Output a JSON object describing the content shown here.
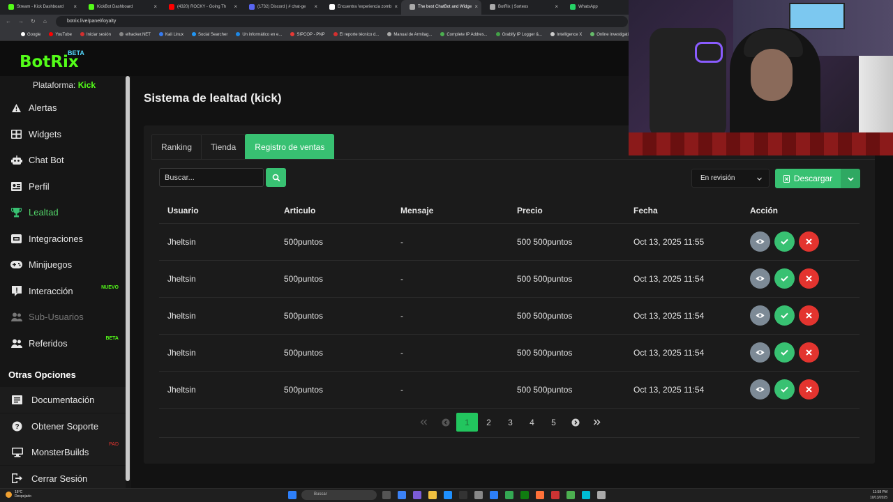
{
  "browser": {
    "tabs": [
      {
        "title": "Stream - Kick Dashboard",
        "color": "#53fc18"
      },
      {
        "title": "KickBot Dashboard",
        "color": "#53fc18"
      },
      {
        "title": "(4320) ROCKY - Going Th",
        "color": "#ff0000"
      },
      {
        "title": "(1732) Discord | # chat-ge",
        "color": "#5865f2"
      },
      {
        "title": "Encuentra 'experiencia zomb",
        "color": "#ffffff"
      },
      {
        "title": "The best ChatBot and Widge",
        "color": "#aaaaaa"
      },
      {
        "title": "BotRix | Sorteos",
        "color": "#aaaaaa"
      },
      {
        "title": "WhatsApp",
        "color": "#25d366"
      }
    ],
    "url": "botrix.live/panel/loyalty",
    "bookmarks": [
      {
        "label": "Google",
        "color": "#ffffff"
      },
      {
        "label": "YouTube",
        "color": "#ff0000"
      },
      {
        "label": "Iniciar sesión",
        "color": "#d32f2f"
      },
      {
        "label": "elhacker.NET",
        "color": "#888888"
      },
      {
        "label": "Kali Linux",
        "color": "#367bf0"
      },
      {
        "label": "Social Searcher",
        "color": "#2196f3"
      },
      {
        "label": "Un informático en e...",
        "color": "#1e88e5"
      },
      {
        "label": "SIPCOP - PNP",
        "color": "#e53935"
      },
      {
        "label": "El reporte técnico d...",
        "color": "#d32f2f"
      },
      {
        "label": "Manual de Armitag...",
        "color": "#aaaaaa"
      },
      {
        "label": "Complete IP Addres...",
        "color": "#4caf50"
      },
      {
        "label": "Grabify IP Logger &...",
        "color": "#43a047"
      },
      {
        "label": "Intelligence X",
        "color": "#cccccc"
      },
      {
        "label": "Online investigation...",
        "color": "#66bb6a"
      }
    ]
  },
  "brand": {
    "name": "BotRix",
    "badge": "BETA"
  },
  "sidebar": {
    "platform_label": "Plataforma:",
    "platform_value": "Kick",
    "items": [
      {
        "label": "Alertas",
        "icon": "warning-icon"
      },
      {
        "label": "Widgets",
        "icon": "widgets-icon"
      },
      {
        "label": "Chat Bot",
        "icon": "robot-icon"
      },
      {
        "label": "Perfil",
        "icon": "profile-icon"
      },
      {
        "label": "Lealtad",
        "icon": "trophy-icon"
      },
      {
        "label": "Integraciones",
        "icon": "integrations-icon"
      },
      {
        "label": "Minijuegos",
        "icon": "gamepad-icon"
      },
      {
        "label": "Interacción",
        "icon": "interaction-icon",
        "tag": "NUEVO"
      },
      {
        "label": "Sub-Usuarios",
        "icon": "users-icon"
      },
      {
        "label": "Referidos",
        "icon": "referrals-icon",
        "tag": "BETA"
      }
    ],
    "other_title": "Otras Opciones",
    "other_items": [
      {
        "label": "Documentación",
        "icon": "document-icon"
      },
      {
        "label": "Obtener Soporte",
        "icon": "help-icon"
      },
      {
        "label": "MonsterBuilds",
        "icon": "monitor-icon",
        "tag": "PAD"
      },
      {
        "label": "Cerrar Sesión",
        "icon": "logout-icon"
      }
    ]
  },
  "page": {
    "title": "Sistema de lealtad (kick)",
    "tabs": [
      "Ranking",
      "Tienda",
      "Registro de ventas"
    ],
    "search_placeholder": "Buscar...",
    "status_filter": "En revisión",
    "download_label": "Descargar"
  },
  "table": {
    "headers": [
      "Usuario",
      "Articulo",
      "Mensaje",
      "Precio",
      "Fecha",
      "Acción"
    ],
    "rows": [
      {
        "user": "Jheltsin",
        "item": "500puntos",
        "message": "-",
        "price": "500 500puntos",
        "date": "Oct 13, 2025 11:55"
      },
      {
        "user": "Jheltsin",
        "item": "500puntos",
        "message": "-",
        "price": "500 500puntos",
        "date": "Oct 13, 2025 11:54"
      },
      {
        "user": "Jheltsin",
        "item": "500puntos",
        "message": "-",
        "price": "500 500puntos",
        "date": "Oct 13, 2025 11:54"
      },
      {
        "user": "Jheltsin",
        "item": "500puntos",
        "message": "-",
        "price": "500 500puntos",
        "date": "Oct 13, 2025 11:54"
      },
      {
        "user": "Jheltsin",
        "item": "500puntos",
        "message": "-",
        "price": "500 500puntos",
        "date": "Oct 13, 2025 11:54"
      }
    ]
  },
  "pagination": {
    "pages": [
      "1",
      "2",
      "3",
      "4",
      "5"
    ],
    "current": "1"
  },
  "taskbar": {
    "temperature": "18°C",
    "weather": "Despejado",
    "search_placeholder": "Buscar",
    "time": "11:58 PM",
    "date": "10/13/2025"
  },
  "colors": {
    "accent": "#38c172",
    "brand": "#53fc18",
    "danger": "#e3342f",
    "muted_button": "#7d8a96"
  }
}
